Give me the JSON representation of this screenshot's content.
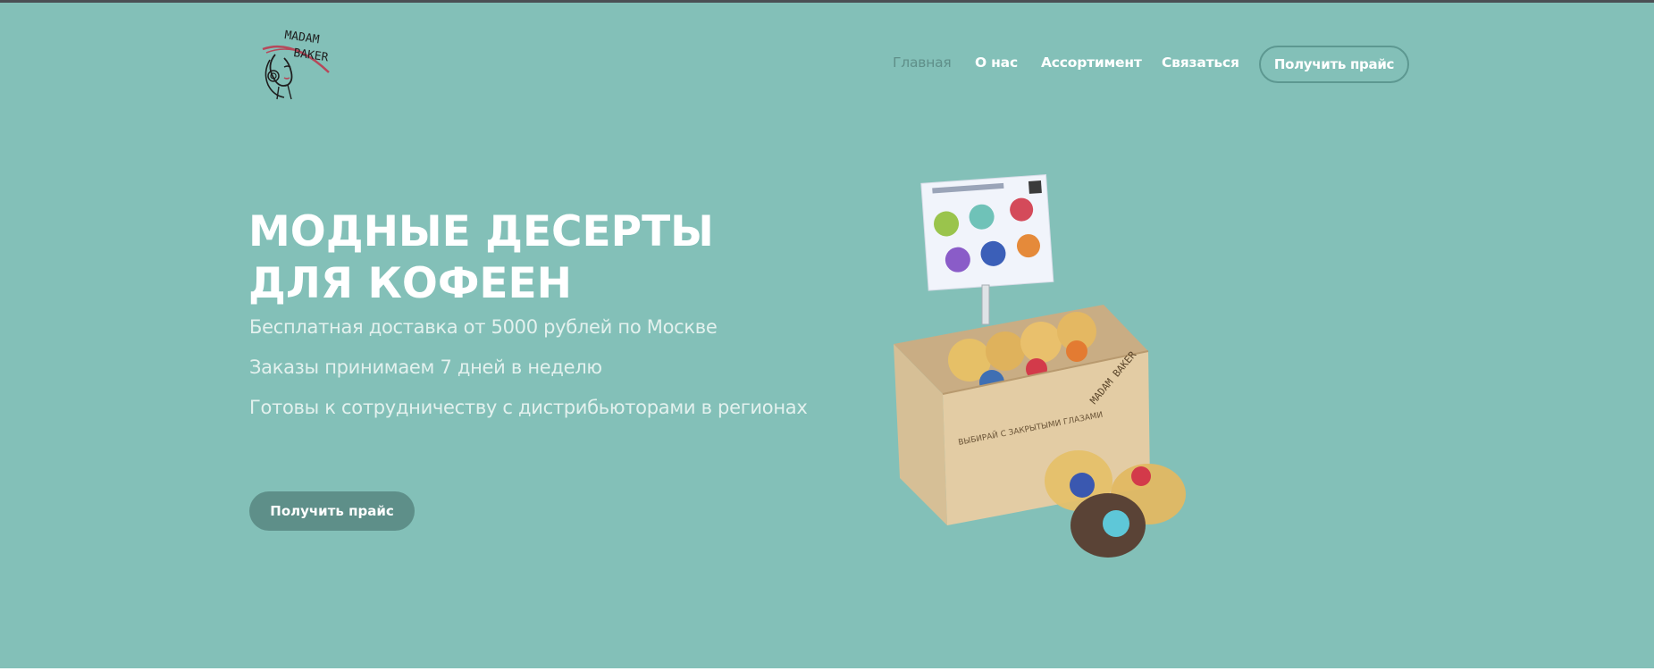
{
  "brand": {
    "logo_text": "MADAM BAKER",
    "logo_line1": "MADAM",
    "logo_line2": "BAKER"
  },
  "nav": {
    "items": [
      {
        "label": "Главная",
        "active": true
      },
      {
        "label": "О нас",
        "active": false
      },
      {
        "label": "Ассортимент",
        "active": false
      },
      {
        "label": "Связаться",
        "active": false
      }
    ],
    "cta_label": "Получить прайс"
  },
  "hero": {
    "title": "МОДНЫЕ ДЕСЕРТЫ ДЛЯ КОФЕЕН",
    "lines": [
      "Бесплатная доставка от 5000 рублей по Москве",
      "Заказы принимаем 7 дней в неделю",
      "Готовы к сотрудничеству с дистрибьюторами в регионах"
    ],
    "cta_label": "Получить прайс"
  },
  "product": {
    "box_text": "ВЫБИРАЙ С ЗАКРЫТЫМИ ГЛАЗАМИ",
    "box_logo": "MADAM BAKER"
  },
  "colors": {
    "hero_bg": "#83c0b8",
    "accent_dark": "#5e8f89",
    "nav_active": "#5f8f89",
    "text": "#ffffff"
  }
}
